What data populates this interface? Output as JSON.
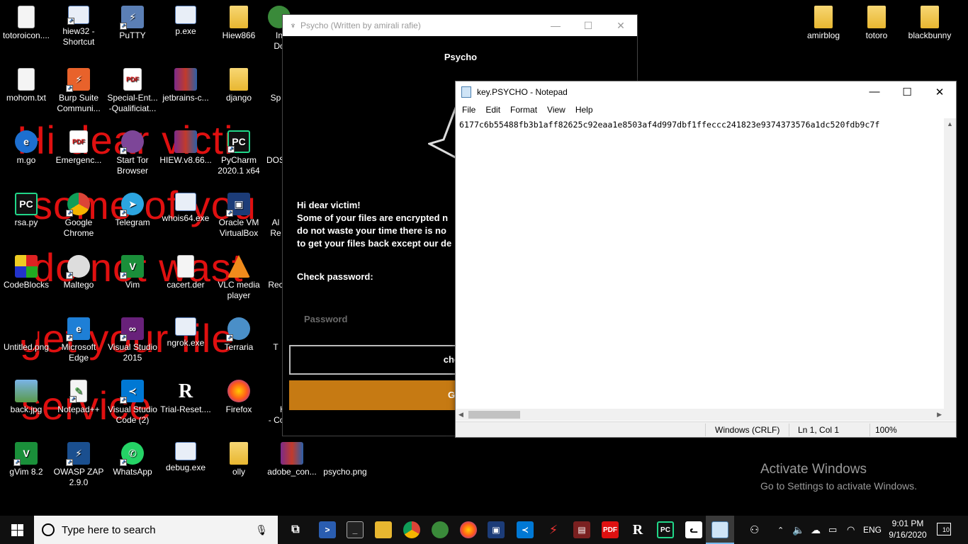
{
  "wallpaper_lines": [
    "Hi dear victi",
    "some of you",
    "do not wast",
    "get your file",
    "service"
  ],
  "desktop_icons": [
    {
      "label": "totoroicon....",
      "kind": "file"
    },
    {
      "label": "hiew32 - Shortcut",
      "kind": "exe"
    },
    {
      "label": "PuTTY",
      "kind": "exe"
    },
    {
      "label": "p.exe",
      "kind": "exe"
    },
    {
      "label": "Hiew866",
      "kind": "folder"
    },
    {
      "label": "mohom.txt",
      "kind": "file"
    },
    {
      "label": "Burp Suite Communi...",
      "kind": "app"
    },
    {
      "label": "Special-Ent... -Qualificiat...",
      "kind": "pdf"
    },
    {
      "label": "jetbrains-c...",
      "kind": "rar"
    },
    {
      "label": "django",
      "kind": "folder"
    },
    {
      "label": "m.go",
      "kind": "app"
    },
    {
      "label": "Emergenc...",
      "kind": "pdf"
    },
    {
      "label": "Start Tor Browser",
      "kind": "app"
    },
    {
      "label": "HIEW.v8.66...",
      "kind": "rar"
    },
    {
      "label": "PyCharm 2020.1 x64",
      "kind": "app"
    },
    {
      "label": "rsa.py",
      "kind": "app"
    },
    {
      "label": "Google Chrome",
      "kind": "app"
    },
    {
      "label": "Telegram",
      "kind": "app"
    },
    {
      "label": "whois64.exe",
      "kind": "exe"
    },
    {
      "label": "Oracle VM VirtualBox",
      "kind": "app"
    },
    {
      "label": "CodeBlocks",
      "kind": "app"
    },
    {
      "label": "Maltego",
      "kind": "app"
    },
    {
      "label": "Vim",
      "kind": "app"
    },
    {
      "label": "cacert.der",
      "kind": "file"
    },
    {
      "label": "VLC media player",
      "kind": "app"
    },
    {
      "label": "Untitled.png",
      "kind": "file"
    },
    {
      "label": "Microsoft Edge",
      "kind": "app"
    },
    {
      "label": "Visual Studio 2015",
      "kind": "app"
    },
    {
      "label": "ngrok.exe",
      "kind": "exe"
    },
    {
      "label": "Terraria",
      "kind": "app"
    },
    {
      "label": "back.jpg",
      "kind": "file"
    },
    {
      "label": "Notepad++",
      "kind": "app"
    },
    {
      "label": "Visual Studio Code (2)",
      "kind": "app"
    },
    {
      "label": "Trial-Reset....",
      "kind": "app"
    },
    {
      "label": "Firefox",
      "kind": "app"
    },
    {
      "label": "gVim 8.2",
      "kind": "app"
    },
    {
      "label": "OWASP ZAP 2.9.0",
      "kind": "app"
    },
    {
      "label": "WhatsApp",
      "kind": "app"
    },
    {
      "label": "debug.exe",
      "kind": "exe"
    },
    {
      "label": "olly",
      "kind": "folder"
    },
    {
      "label": "adobe_con...",
      "kind": "rar"
    },
    {
      "label": "psycho.png",
      "kind": "file"
    },
    {
      "label": "amirblog",
      "kind": "folder"
    },
    {
      "label": "totoro",
      "kind": "folder"
    },
    {
      "label": "blackbunny",
      "kind": "folder"
    }
  ],
  "partial_icons": [
    "In",
    "Do",
    "Sp",
    "DOS",
    "Al",
    "Re",
    "Rec",
    "T",
    "Hen",
    "- Copy.pdf"
  ],
  "psycho": {
    "title": "Psycho (Written by amirali rafie)",
    "heading": "Psycho",
    "message_lines": [
      "Hi dear victim!",
      "Some of your files are encrypted n",
      "do not waste your time there is no",
      "to get your files back except our de"
    ],
    "check_label": "Check password:",
    "password_placeholder": "Password",
    "check_button": "check p",
    "get_button": "Get vi"
  },
  "notepad": {
    "title": "key.PSYCHO - Notepad",
    "menu": [
      "File",
      "Edit",
      "Format",
      "View",
      "Help"
    ],
    "content": "6177c6b55488fb3b1aff82625c92eaa1e8503af4d997dbf1ffeccc241823e9374373576a1dc520fdb9c7f",
    "status_encoding": "Windows (CRLF)",
    "status_position": "Ln 1, Col 1",
    "status_zoom": "100%"
  },
  "activate": {
    "line1": "Activate Windows",
    "line2": "Go to Settings to activate Windows."
  },
  "taskbar": {
    "search_placeholder": "Type here to search",
    "language": "ENG",
    "time": "9:01 PM",
    "date": "9/16/2020",
    "notification_count": "10"
  },
  "colors": {
    "wallpaper_text": "#e01010",
    "get_button": "#c67a13",
    "taskbar": "#101010"
  }
}
